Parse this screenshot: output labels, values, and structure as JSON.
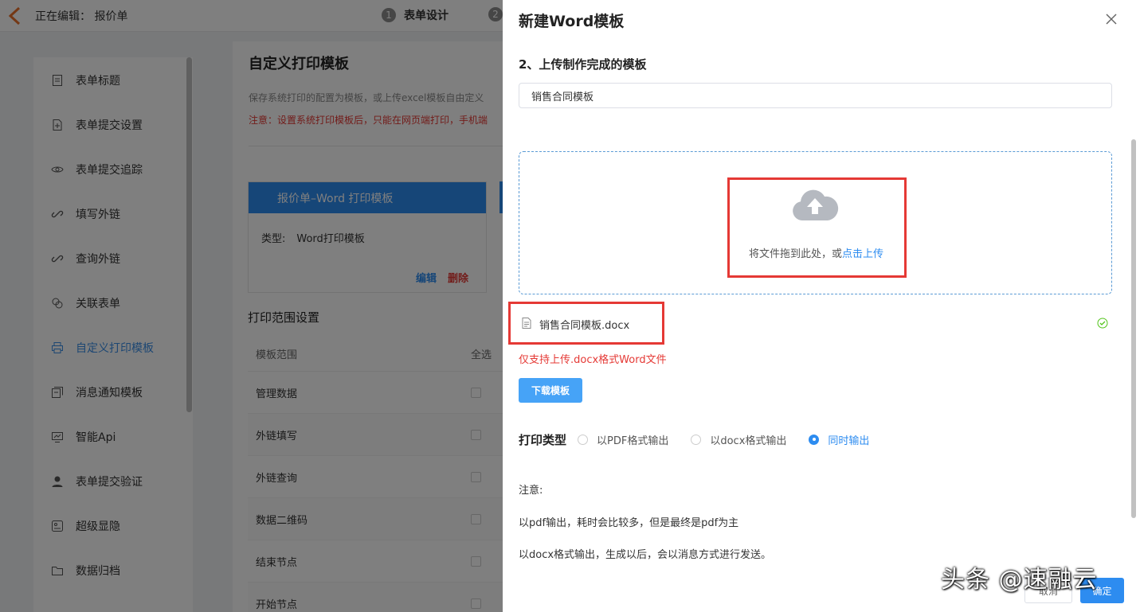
{
  "topbar": {
    "editing_label": "正在编辑：  报价单",
    "steps": [
      {
        "num": "1",
        "label": "表单设计"
      },
      {
        "num": "2",
        "label": ""
      }
    ]
  },
  "sidebar": {
    "items": [
      {
        "label": "表单标题",
        "icon": "document-icon"
      },
      {
        "label": "表单提交设置",
        "icon": "file-add-icon"
      },
      {
        "label": "表单提交追踪",
        "icon": "eye-icon"
      },
      {
        "label": "填写外链",
        "icon": "link-icon"
      },
      {
        "label": "查询外链",
        "icon": "link-icon"
      },
      {
        "label": "关联表单",
        "icon": "relation-icon"
      },
      {
        "label": "自定义打印模板",
        "icon": "printer-icon"
      },
      {
        "label": "消息通知模板",
        "icon": "message-icon"
      },
      {
        "label": "智能Api",
        "icon": "api-icon"
      },
      {
        "label": "表单提交验证",
        "icon": "user-icon"
      },
      {
        "label": "超级显隐",
        "icon": "visibility-icon"
      },
      {
        "label": "数据归档",
        "icon": "folder-icon"
      }
    ],
    "active_index": 6
  },
  "main": {
    "title": "自定义打印模板",
    "desc": "保存系统打印的配置为模板，或上传excel模板自由定义",
    "warning": "注意：设置系统打印模板后，只能在网页端打印，手机端",
    "template_card": {
      "header": "报价单–Word 打印模板",
      "type_label": "类型:",
      "type_value": "Word打印模板",
      "edit": "编辑",
      "delete": "删除"
    },
    "range_title": "打印范围设置",
    "range_headers": {
      "name": "模板范围",
      "select_all": "全选"
    },
    "range_rows": [
      "管理数据",
      "外链填写",
      "外链查询",
      "数据二维码",
      "结束节点",
      "开始节点"
    ]
  },
  "drawer": {
    "title": "新建Word模板",
    "section_title": "2、上传制作完成的模板",
    "template_name": "销售合同模板",
    "drop_text": "将文件拖到此处，或",
    "drop_link": "点击上传",
    "file_name": "销售合同模板.docx",
    "file_hint": "仅支持上传.docx格式Word文件",
    "download_btn": "下载模板",
    "print_type_label": "打印类型",
    "print_options": [
      {
        "label": "以PDF格式输出",
        "checked": false
      },
      {
        "label": "以docx格式输出",
        "checked": false
      },
      {
        "label": "同时输出",
        "checked": true
      }
    ],
    "notes": [
      "注意:",
      "以pdf输出，耗时会比较多，但是最终是pdf为主",
      "以docx格式输出，生成以后，会以消息方式进行发送。"
    ],
    "footer_cancel": "取消",
    "footer_ok": "确定"
  },
  "watermark": "头条 @速融云",
  "colors": {
    "accent": "#2d8cf0",
    "danger": "#e53935",
    "success": "#52c41a"
  }
}
